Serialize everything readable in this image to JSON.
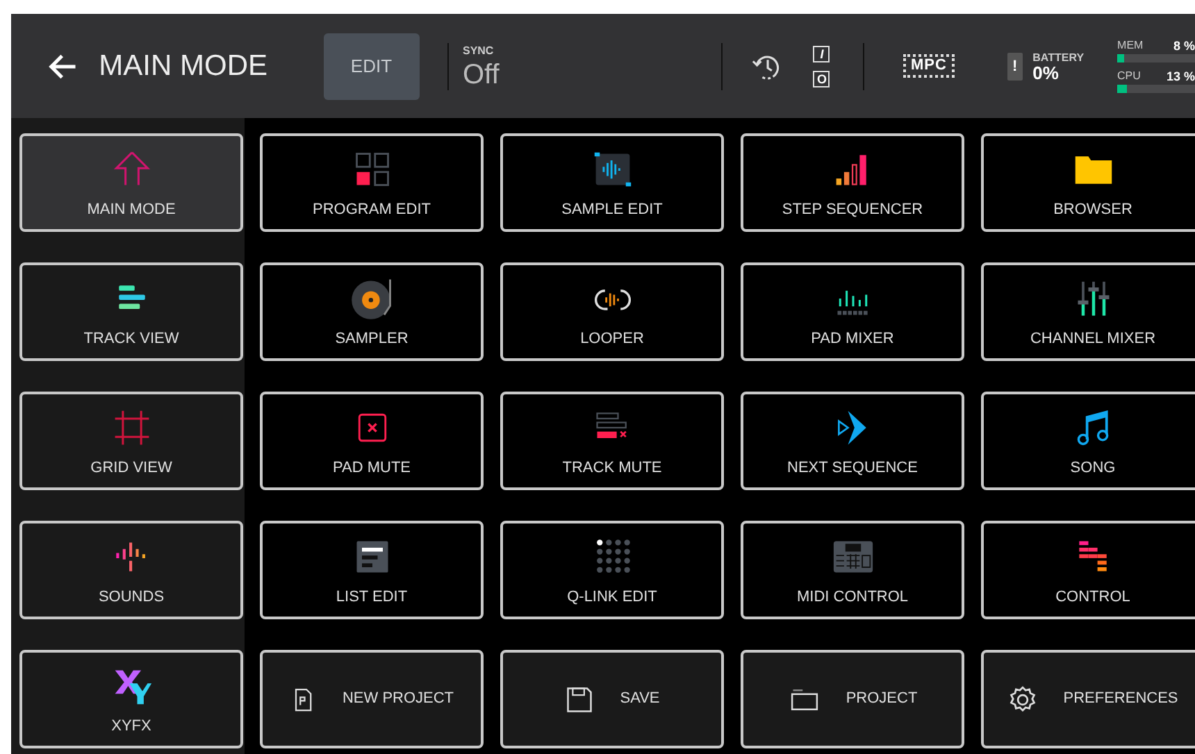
{
  "header": {
    "title": "MAIN MODE",
    "edit_button": "EDIT",
    "sync": {
      "label": "SYNC",
      "value": "Off"
    },
    "punch_in": "I",
    "punch_out": "O",
    "logo": "MPC",
    "battery": {
      "alert": "!",
      "label": "BATTERY",
      "value": "0%"
    },
    "meters": [
      {
        "label": "MEM",
        "reading": "8 %",
        "level": 0.08
      },
      {
        "label": "CPU",
        "reading": "13 %",
        "level": 0.13
      }
    ]
  },
  "tiles": [
    {
      "label": "MAIN MODE",
      "kind": "mode",
      "selected": true
    },
    {
      "label": "PROGRAM EDIT",
      "kind": "mode",
      "selected": false
    },
    {
      "label": "SAMPLE EDIT",
      "kind": "mode",
      "selected": false
    },
    {
      "label": "STEP SEQUENCER",
      "kind": "mode",
      "selected": false
    },
    {
      "label": "BROWSER",
      "kind": "mode",
      "selected": false
    },
    {
      "label": "TRACK VIEW",
      "kind": "mode",
      "selected": false
    },
    {
      "label": "SAMPLER",
      "kind": "mode",
      "selected": false
    },
    {
      "label": "LOOPER",
      "kind": "mode",
      "selected": false
    },
    {
      "label": "PAD MIXER",
      "kind": "mode",
      "selected": false
    },
    {
      "label": "CHANNEL MIXER",
      "kind": "mode",
      "selected": false
    },
    {
      "label": "GRID VIEW",
      "kind": "mode",
      "selected": false
    },
    {
      "label": "PAD MUTE",
      "kind": "mode",
      "selected": false
    },
    {
      "label": "TRACK MUTE",
      "kind": "mode",
      "selected": false
    },
    {
      "label": "NEXT SEQUENCE",
      "kind": "mode",
      "selected": false
    },
    {
      "label": "SONG",
      "kind": "mode",
      "selected": false
    },
    {
      "label": "SOUNDS",
      "kind": "mode",
      "selected": false
    },
    {
      "label": "LIST EDIT",
      "kind": "mode",
      "selected": false
    },
    {
      "label": "Q-LINK EDIT",
      "kind": "mode",
      "selected": false
    },
    {
      "label": "MIDI CONTROL",
      "kind": "mode",
      "selected": false
    },
    {
      "label": "CONTROL",
      "kind": "mode",
      "selected": false
    },
    {
      "label": "XYFX",
      "kind": "mode",
      "selected": false
    },
    {
      "label": "NEW PROJECT",
      "kind": "action",
      "selected": false
    },
    {
      "label": "SAVE",
      "kind": "action",
      "selected": false
    },
    {
      "label": "PROJECT",
      "kind": "action",
      "selected": false
    },
    {
      "label": "PREFERENCES",
      "kind": "action",
      "selected": false
    }
  ]
}
